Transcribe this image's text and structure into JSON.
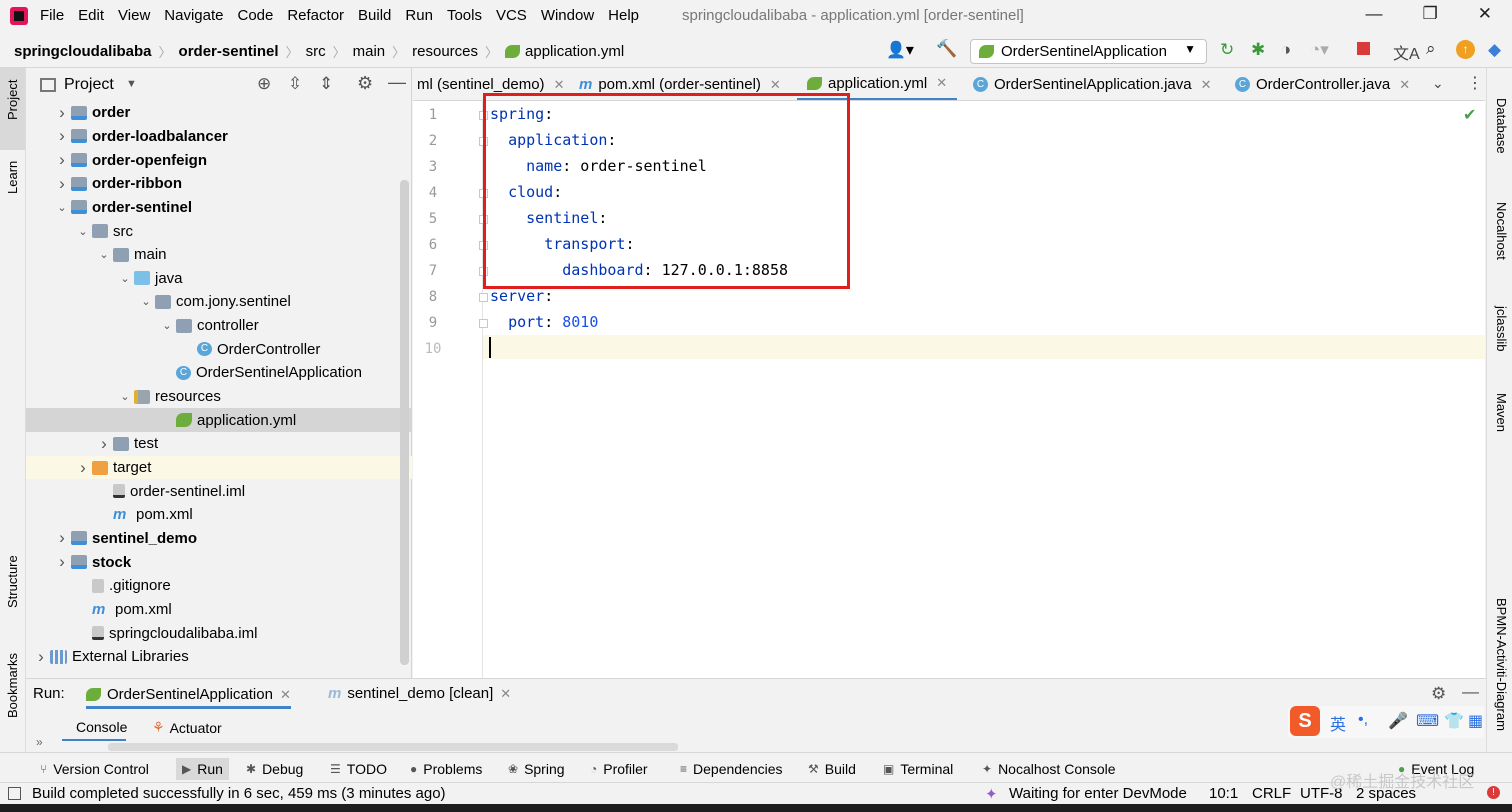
{
  "window": {
    "title": "springcloudalibaba - application.yml [order-sentinel]",
    "menus": [
      "File",
      "Edit",
      "View",
      "Navigate",
      "Code",
      "Refactor",
      "Build",
      "Run",
      "Tools",
      "VCS",
      "Window",
      "Help"
    ]
  },
  "breadcrumb": [
    "springcloudalibaba",
    "order-sentinel",
    "src",
    "main",
    "resources",
    "application.yml"
  ],
  "run_config": "OrderSentinelApplication",
  "project": {
    "title": "Project",
    "tree": [
      {
        "label": "order",
        "level": 1,
        "arrow": "›",
        "icon": "mod",
        "bold": true
      },
      {
        "label": "order-loadbalancer",
        "level": 1,
        "arrow": "›",
        "icon": "mod",
        "bold": true
      },
      {
        "label": "order-openfeign",
        "level": 1,
        "arrow": "›",
        "icon": "mod",
        "bold": true
      },
      {
        "label": "order-ribbon",
        "level": 1,
        "arrow": "›",
        "icon": "mod",
        "bold": true
      },
      {
        "label": "order-sentinel",
        "level": 1,
        "arrow": "⌄",
        "icon": "mod",
        "bold": true
      },
      {
        "label": "src",
        "level": 2,
        "arrow": "⌄",
        "icon": "folder"
      },
      {
        "label": "main",
        "level": 3,
        "arrow": "⌄",
        "icon": "folder"
      },
      {
        "label": "java",
        "level": 4,
        "arrow": "⌄",
        "icon": "java"
      },
      {
        "label": "com.jony.sentinel",
        "level": 5,
        "arrow": "⌄",
        "icon": "folder"
      },
      {
        "label": "controller",
        "level": 6,
        "arrow": "⌄",
        "icon": "folder"
      },
      {
        "label": "OrderController",
        "level": 7,
        "arrow": "",
        "icon": "cls"
      },
      {
        "label": "OrderSentinelApplication",
        "level": 7,
        "arrow": "",
        "icon": "cls-spring",
        "offset": -1
      },
      {
        "label": "resources",
        "level": 4,
        "arrow": "⌄",
        "icon": "res"
      },
      {
        "label": "application.yml",
        "level": 6,
        "arrow": "",
        "icon": "spring",
        "selected": true
      },
      {
        "label": "test",
        "level": 3,
        "arrow": "›",
        "icon": "folder"
      },
      {
        "label": "target",
        "level": 2,
        "arrow": "›",
        "icon": "orange",
        "highlight": true
      },
      {
        "label": "order-sentinel.iml",
        "level": 3,
        "arrow": "",
        "icon": "file"
      },
      {
        "label": "pom.xml",
        "level": 3,
        "arrow": "",
        "icon": "maven"
      },
      {
        "label": "sentinel_demo",
        "level": 1,
        "arrow": "›",
        "icon": "mod",
        "bold": true
      },
      {
        "label": "stock",
        "level": 1,
        "arrow": "›",
        "icon": "mod",
        "bold": true
      },
      {
        "label": ".gitignore",
        "level": 2,
        "arrow": "",
        "icon": "git"
      },
      {
        "label": "pom.xml",
        "level": 2,
        "arrow": "",
        "icon": "maven"
      },
      {
        "label": "springcloudalibaba.iml",
        "level": 2,
        "arrow": "",
        "icon": "file"
      },
      {
        "label": "External Libraries",
        "level": 0,
        "arrow": "›",
        "icon": "lib"
      }
    ]
  },
  "tabs": [
    {
      "label": "ml (sentinel_demo)",
      "icon": "none"
    },
    {
      "label": "pom.xml (order-sentinel)",
      "icon": "maven"
    },
    {
      "label": "application.yml",
      "icon": "spring",
      "active": true
    },
    {
      "label": "OrderSentinelApplication.java",
      "icon": "cls"
    },
    {
      "label": "OrderController.java",
      "icon": "cls"
    }
  ],
  "editor": {
    "line_numbers": [
      "1",
      "2",
      "3",
      "4",
      "5",
      "6",
      "7",
      "8",
      "9",
      "10"
    ],
    "lines": [
      {
        "indent": "",
        "key": "spring",
        "value": ""
      },
      {
        "indent": "  ",
        "key": "application",
        "value": ""
      },
      {
        "indent": "    ",
        "key": "name",
        "value": " order-sentinel"
      },
      {
        "indent": "  ",
        "key": "cloud",
        "value": ""
      },
      {
        "indent": "    ",
        "key": "sentinel",
        "value": ""
      },
      {
        "indent": "      ",
        "key": "transport",
        "value": ""
      },
      {
        "indent": "        ",
        "key": "dashboard",
        "value": " 127.0.0.1:8858"
      },
      {
        "indent": "",
        "key": "server",
        "value": ""
      },
      {
        "indent": "  ",
        "key": "port",
        "value": " 8010",
        "numeric": true
      },
      {
        "indent": "",
        "key": "",
        "value": ""
      }
    ]
  },
  "left_strip": [
    "Project",
    "Learn",
    "Structure",
    "Bookmarks"
  ],
  "right_strip": [
    "Database",
    "Nocalhost",
    "jclasslib",
    "Maven",
    "BPMN-Activiti-Diagram"
  ],
  "run_panel": {
    "label": "Run:",
    "tabs": [
      "OrderSentinelApplication",
      "sentinel_demo [clean]"
    ],
    "subtabs": [
      "Console",
      "Actuator"
    ]
  },
  "tool_windows": [
    "Version Control",
    "Run",
    "Debug",
    "TODO",
    "Problems",
    "Spring",
    "Profiler",
    "Dependencies",
    "Build",
    "Terminal",
    "Nocalhost Console",
    "Event Log"
  ],
  "status": {
    "message": "Build completed successfully in 6 sec, 459 ms (3 minutes ago)",
    "devmode": "Waiting for enter DevMode",
    "position": "10:1",
    "line_sep": "CRLF",
    "encoding": "UTF-8",
    "indent": "2 spaces"
  },
  "ime": {
    "logo": "S",
    "lang": "英"
  },
  "watermark": "@稀土掘金技术社区",
  "colors": {
    "accent": "#4083c9",
    "highlight_box": "#e01e1e",
    "yaml_key": "#0033b3",
    "yaml_number": "#1750eb"
  }
}
